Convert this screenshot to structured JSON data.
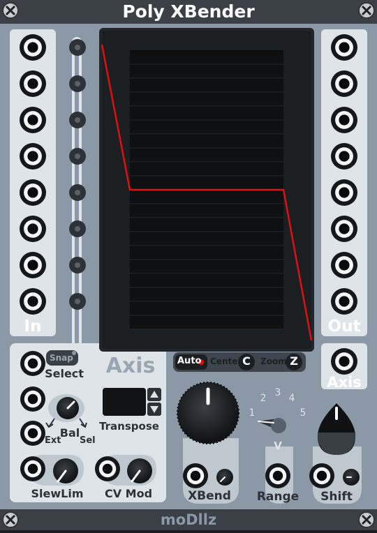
{
  "module": {
    "title": "Poly XBender",
    "brand": "moDllz"
  },
  "io": {
    "in_label": "In",
    "out_label": "Out",
    "axis_out_label": "Axis"
  },
  "display": {
    "auto_label": "Auto",
    "center_label": "Center",
    "center_button": "C",
    "zoom_label": "Zoom",
    "zoom_button": "Z"
  },
  "axis_section": {
    "title": "Axis",
    "snap_label": "Snap",
    "select_label": "Select",
    "bal_label": "Bal",
    "ext_label": "Ext",
    "sel_label": "Sel",
    "transpose_label": "Transpose",
    "slewlim_label": "SlewLim",
    "cvmod_label": "CV Mod"
  },
  "controls": {
    "xbend_label": "XBend",
    "range_label": "Range",
    "shift_label": "Shift",
    "range_scale": [
      "1",
      "2",
      "3",
      "4",
      "5"
    ],
    "range_unit": "V"
  },
  "colors": {
    "panel": "#8b98a5",
    "header": "#3a4046",
    "accent_red": "#e01010",
    "io_panel": "#dfe4e9"
  }
}
